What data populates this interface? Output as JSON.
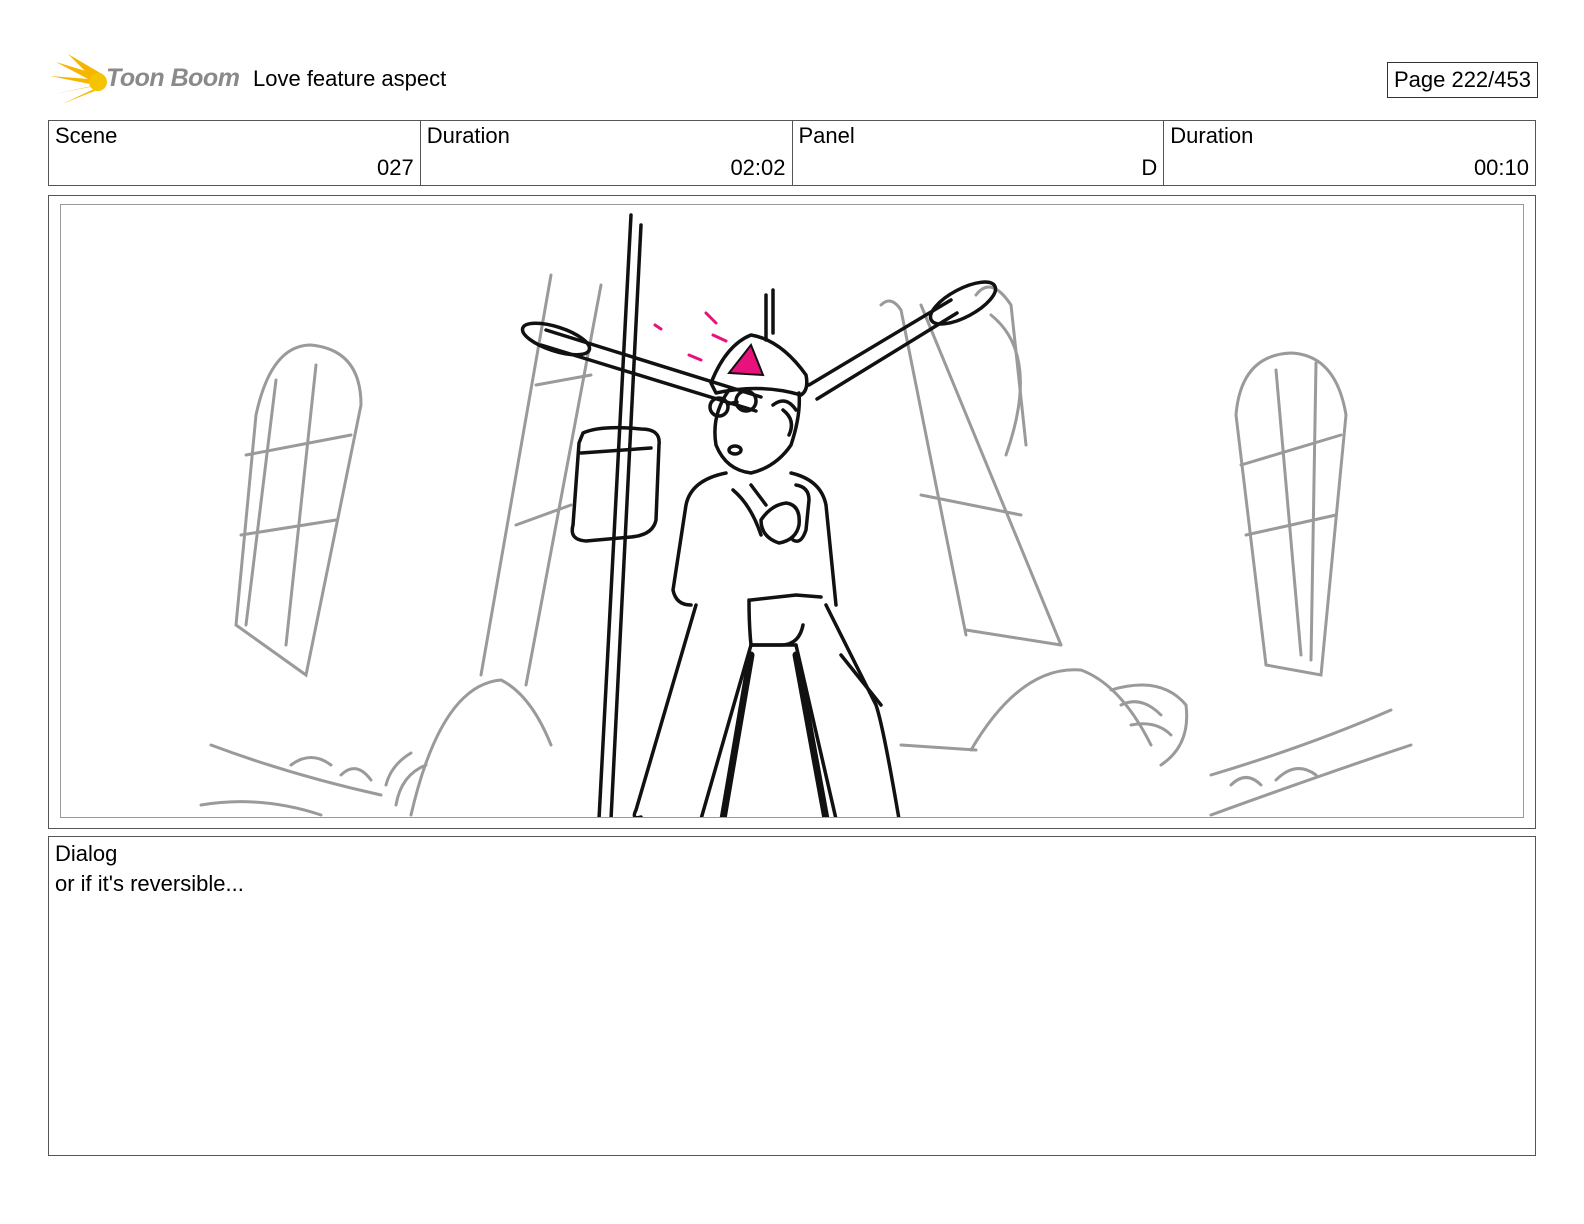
{
  "header": {
    "logo_text": "Toon Boom",
    "title": "Love feature aspect",
    "page": "Page 222/453"
  },
  "info": {
    "scene_label": "Scene",
    "scene_value": "027",
    "scene_duration_label": "Duration",
    "scene_duration_value": "02:02",
    "panel_label": "Panel",
    "panel_value": "D",
    "panel_duration_label": "Duration",
    "panel_duration_value": "00:10"
  },
  "panel": {
    "accent_color": "#e8127c",
    "line_color": "#111111",
    "background_line_color": "#9a9a9a"
  },
  "dialog": {
    "label": "Dialog",
    "text": "or if it's reversible..."
  }
}
